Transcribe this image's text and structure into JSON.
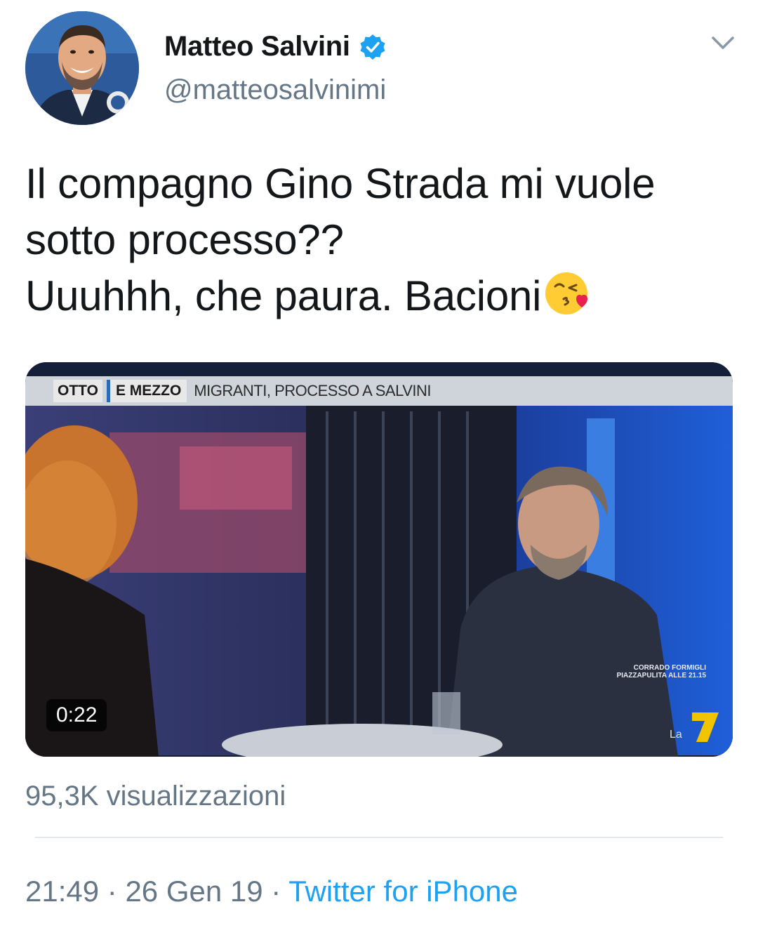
{
  "author": {
    "display_name": "Matteo Salvini",
    "handle": "@matteosalvinimi",
    "verified": true,
    "avatar_icon": "profile-photo"
  },
  "tweet": {
    "lines": [
      "Il compagno Gino Strada mi vuole",
      "sotto processo??",
      "Uuuhhh, che paura. Bacioni"
    ],
    "emoji": "face-blowing-a-kiss"
  },
  "media": {
    "banner_show": "OTTO",
    "banner_show2": "E MEZZO",
    "banner_topic": "MIGRANTI, PROCESSO A SALVINI",
    "overlay_caption": "CORRADO FORMIGLI PIAZZAPULITA ALLE 21.15",
    "duration": "0:22"
  },
  "stats": {
    "views": "95,3K visualizzazioni"
  },
  "meta": {
    "time": "21:49",
    "date": "26 Gen 19",
    "separator": " · ",
    "source": "Twitter for iPhone"
  },
  "colors": {
    "link": "#1da1f2",
    "secondary": "#657786",
    "verified": "#1da1f2"
  }
}
